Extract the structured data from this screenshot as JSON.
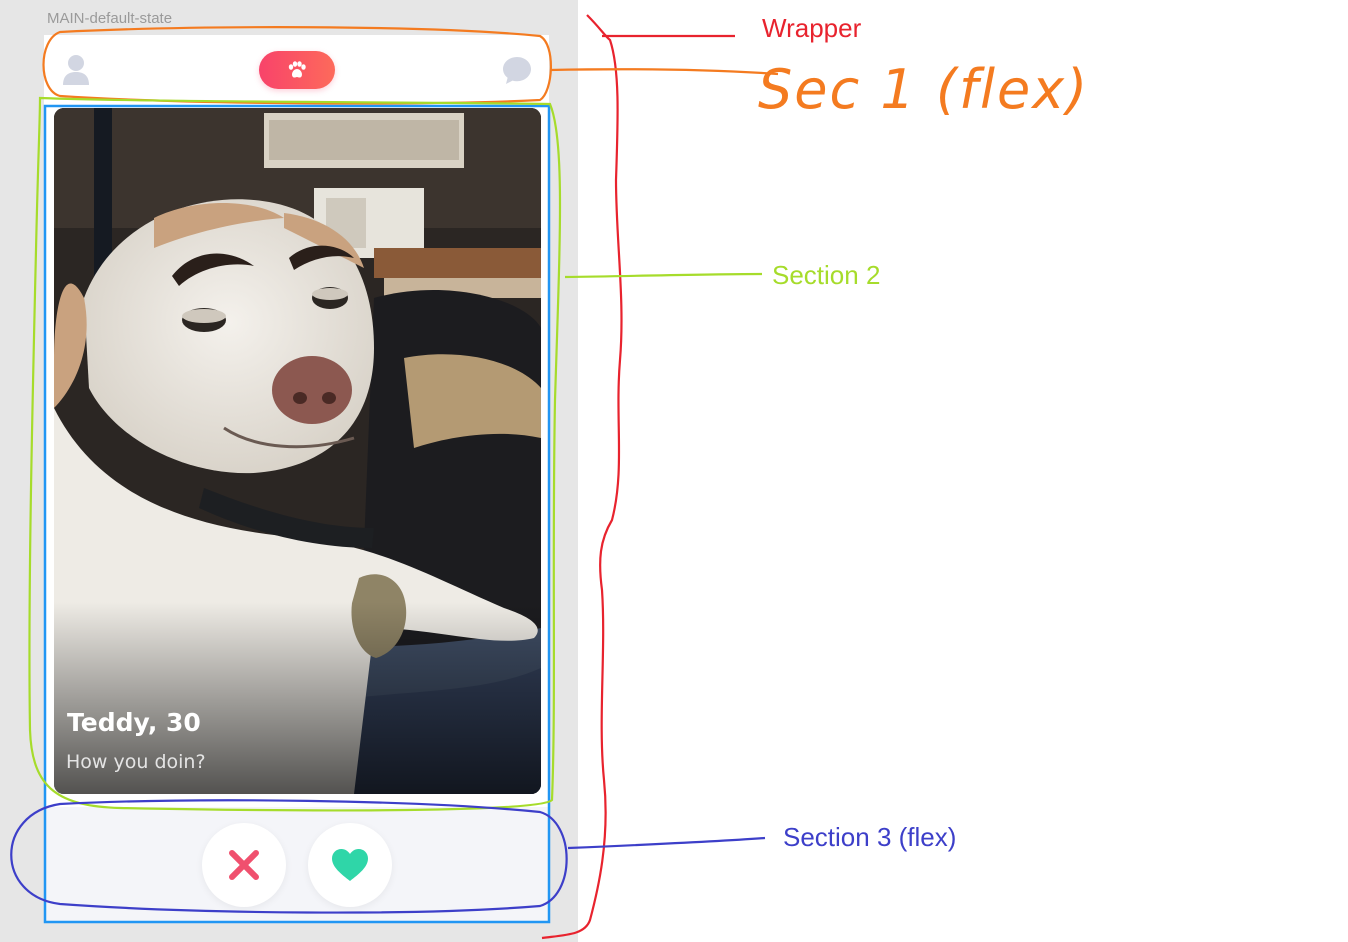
{
  "artboard": {
    "label": "MAIN-default-state"
  },
  "header": {
    "profile_icon": "person-icon",
    "logo_icon": "paw-icon",
    "messages_icon": "chat-bubble-icon"
  },
  "card": {
    "name": "Teddy, 30",
    "bio": "How you doin?",
    "photo": "dog-photo"
  },
  "actions": {
    "dislike_icon": "cross-icon",
    "like_icon": "heart-icon"
  },
  "annotations": {
    "wrapper": "Wrapper",
    "section1": "Sec 1 (flex)",
    "section2": "Section 2",
    "section3": "Section 3 (flex)"
  },
  "colors": {
    "accent": "#f8436a",
    "dislike": "#f0506e",
    "like": "#2fd6a8",
    "wrapper_annotation": "#e8232e",
    "section1_annotation": "#f47b20",
    "section2_annotation": "#a6dc2b",
    "section3_annotation": "#3d3fc9",
    "app_outline": "#2196f3"
  }
}
